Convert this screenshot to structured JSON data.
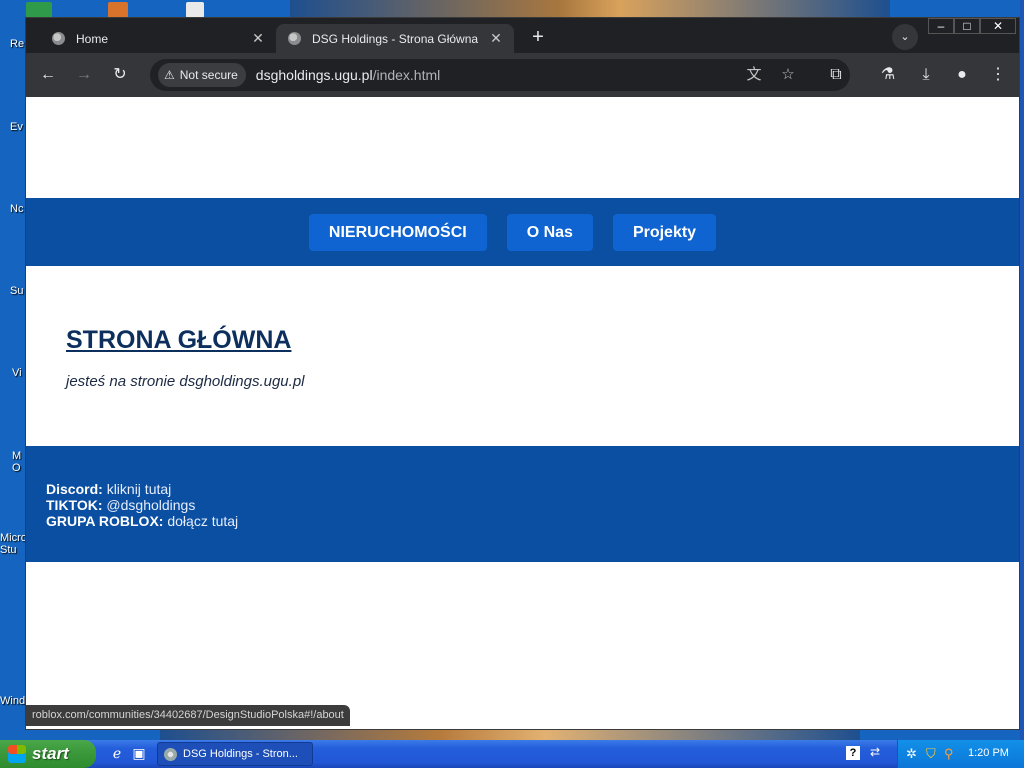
{
  "desktop": {
    "icon_labels": [
      "Re",
      "Ev",
      "Nc",
      "Su",
      "Vi",
      "M O",
      "Micro Stu",
      "Wind"
    ]
  },
  "browser": {
    "tabs": [
      {
        "title": "Home",
        "active": false
      },
      {
        "title": "DSG Holdings - Strona Główna",
        "active": true
      }
    ],
    "new_tab_icon": "plus-icon",
    "security_label": "Not secure",
    "url_host": "dsgholdings.ugu.pl",
    "url_path": "/index.html",
    "status_url": "roblox.com/communities/34402687/DesignStudioPolska#!/about"
  },
  "page": {
    "nav": [
      "NIERUCHOMOŚCI",
      "O Nas",
      "Projekty"
    ],
    "heading": "STRONA GŁÓWNA",
    "subtitle": "jesteś na stronie dsgholdings.ugu.pl",
    "footer": [
      {
        "label": "Discord:",
        "value": "kliknij tutaj"
      },
      {
        "label": "TIKTOK:",
        "value": "@dsgholdings"
      },
      {
        "label": "GRUPA ROBLOX:",
        "value": "dołącz tutaj"
      }
    ],
    "colors": {
      "nav_bg": "#0b4fa3",
      "nav_button": "#0f64d1",
      "heading": "#0d2f5e"
    }
  },
  "taskbar": {
    "start_label": "start",
    "task_title": "DSG Holdings - Stron...",
    "clock": "1:20 PM"
  }
}
